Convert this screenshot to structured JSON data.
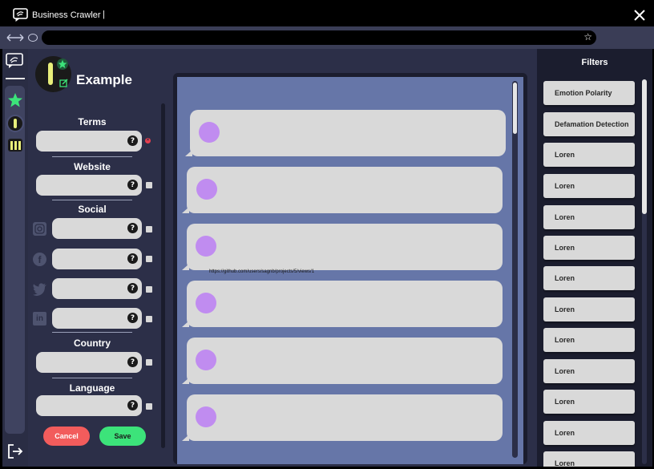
{
  "window": {
    "title": "Business Crawler",
    "caret": "|"
  },
  "browser": {
    "url": "",
    "star": "☆"
  },
  "profile": {
    "name": "Example"
  },
  "form": {
    "terms_label": "Terms",
    "website_label": "Website",
    "social_label": "Social",
    "country_label": "Country",
    "language_label": "Language",
    "help_glyph": "?",
    "cancel_label": "Cancel",
    "save_label": "Save"
  },
  "feed": {
    "link_text": "https://github.com/users/sagnb/projects/5/views/1"
  },
  "filters": {
    "title": "Filters",
    "items": [
      "Emotion Polarity",
      "Defamation Detection",
      "Loren",
      "Loren",
      "Loren",
      "Loren",
      "Loren",
      "Loren",
      "Loren",
      "Loren",
      "Loren",
      "Loren",
      "Loren"
    ]
  },
  "colors": {
    "accent_green": "#3ce37a",
    "accent_yellow": "#e8ee7a",
    "avatar_purple": "#c08cf0",
    "cancel_red": "#f25c5c",
    "save_green": "#3ce37a"
  }
}
